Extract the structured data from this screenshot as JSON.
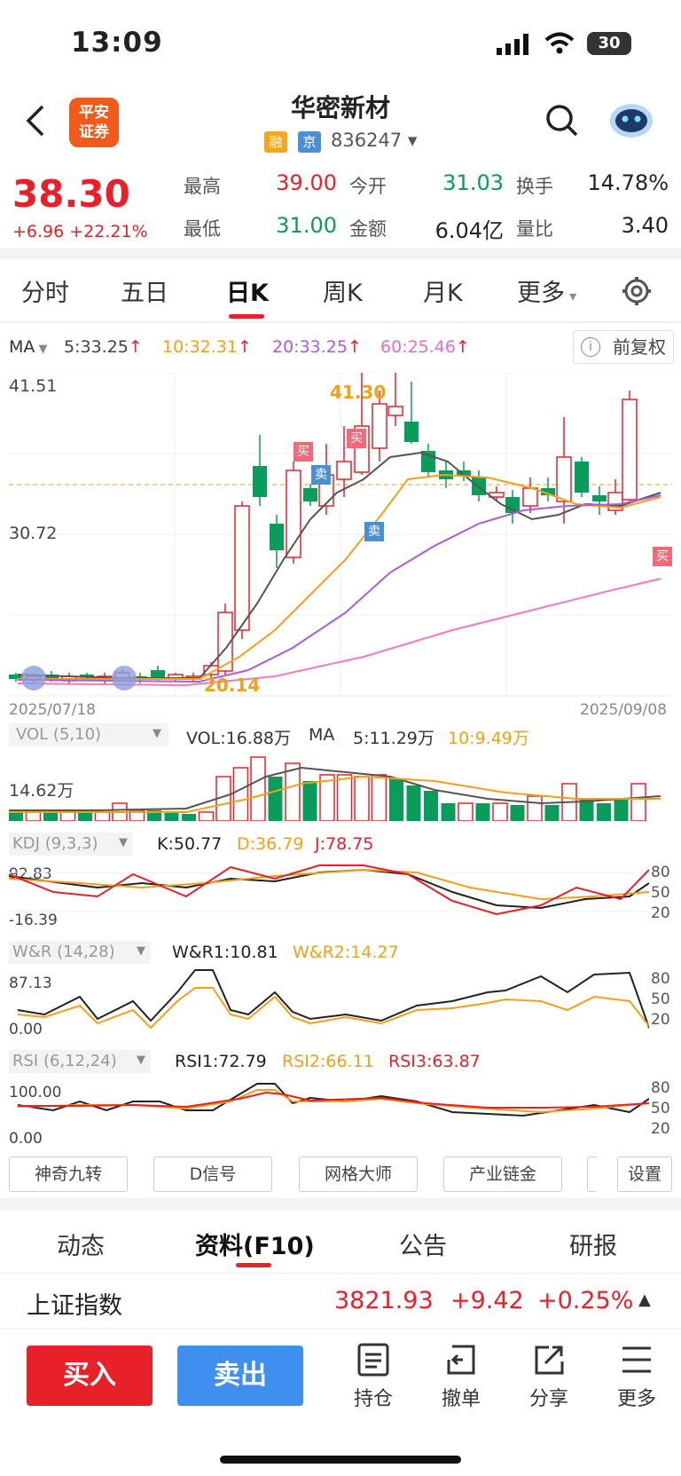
{
  "status": {
    "time": "13:09",
    "battery": "30"
  },
  "header": {
    "title": "华密新材",
    "logo_line1": "平安",
    "logo_line2": "证券",
    "tag1": "融",
    "tag2": "京",
    "code": "836247"
  },
  "quote": {
    "price": "38.30",
    "change": "+6.96 +22.21%",
    "high_label": "最高",
    "high": "39.00",
    "open_label": "今开",
    "open": "31.03",
    "turnover_label": "换手",
    "turnover": "14.78%",
    "low_label": "最低",
    "low": "31.00",
    "amount_label": "金额",
    "amount": "6.04亿",
    "vol_ratio_label": "量比",
    "vol_ratio": "3.40"
  },
  "period_tabs": [
    "分时",
    "五日",
    "日K",
    "周K",
    "月K",
    "更多"
  ],
  "ma": {
    "label": "MA",
    "ma5": "5:33.25",
    "ma10": "10:32.31",
    "ma20": "20:33.25",
    "ma60": "60:25.46",
    "fq": "前复权"
  },
  "kline": {
    "y_top": "41.51",
    "y_mid": "30.72",
    "max_label": "41.30",
    "min_label": "20.14",
    "date_start": "2025/07/18",
    "date_end": "2025/09/08",
    "buy_marker": "买",
    "sell_marker": "卖"
  },
  "vol": {
    "title": "VOL (5,10)",
    "vol": "VOL:16.88万",
    "ma_label": "MA",
    "ma5": "5:11.29万",
    "ma10": "10:9.49万",
    "y": "14.62万"
  },
  "kdj": {
    "title": "KDJ (9,3,3)",
    "k": "K:50.77",
    "d": "D:36.79",
    "j": "J:78.75",
    "y_top": "92.83",
    "y_bot": "-16.39",
    "r1": "80",
    "r2": "50",
    "r3": "20"
  },
  "wr": {
    "title": "W&R (14,28)",
    "wr1": "W&R1:10.81",
    "wr2": "W&R2:14.27",
    "y_top": "87.13",
    "y_bot": "0.00",
    "r1": "80",
    "r2": "50",
    "r3": "20"
  },
  "rsi": {
    "title": "RSI (6,12,24)",
    "rsi1": "RSI1:72.79",
    "rsi2": "RSI2:66.11",
    "rsi3": "RSI3:63.87",
    "y_top": "100.00",
    "y_bot": "0.00",
    "r1": "80",
    "r2": "50",
    "r3": "20"
  },
  "tools": [
    "神奇九转",
    "D信号",
    "网格大师",
    "产业链金",
    "设置"
  ],
  "bottom_tabs": [
    "动态",
    "资料(F10)",
    "公告",
    "研报"
  ],
  "index": {
    "name": "上证指数",
    "value": "3821.93",
    "change": "+9.42",
    "pct": "+0.25%"
  },
  "actions": {
    "buy": "买入",
    "sell": "卖出",
    "hold": "持仓",
    "cancel": "撤单",
    "share": "分享",
    "more": "更多"
  },
  "colors": {
    "up": "#e8202a",
    "down": "#0a9c5b",
    "ma5": "#555555",
    "ma10": "#f2a01a",
    "ma20": "#a85ce0",
    "ma60": "#f07ac0",
    "accent_blue": "#3f8ff0"
  }
}
